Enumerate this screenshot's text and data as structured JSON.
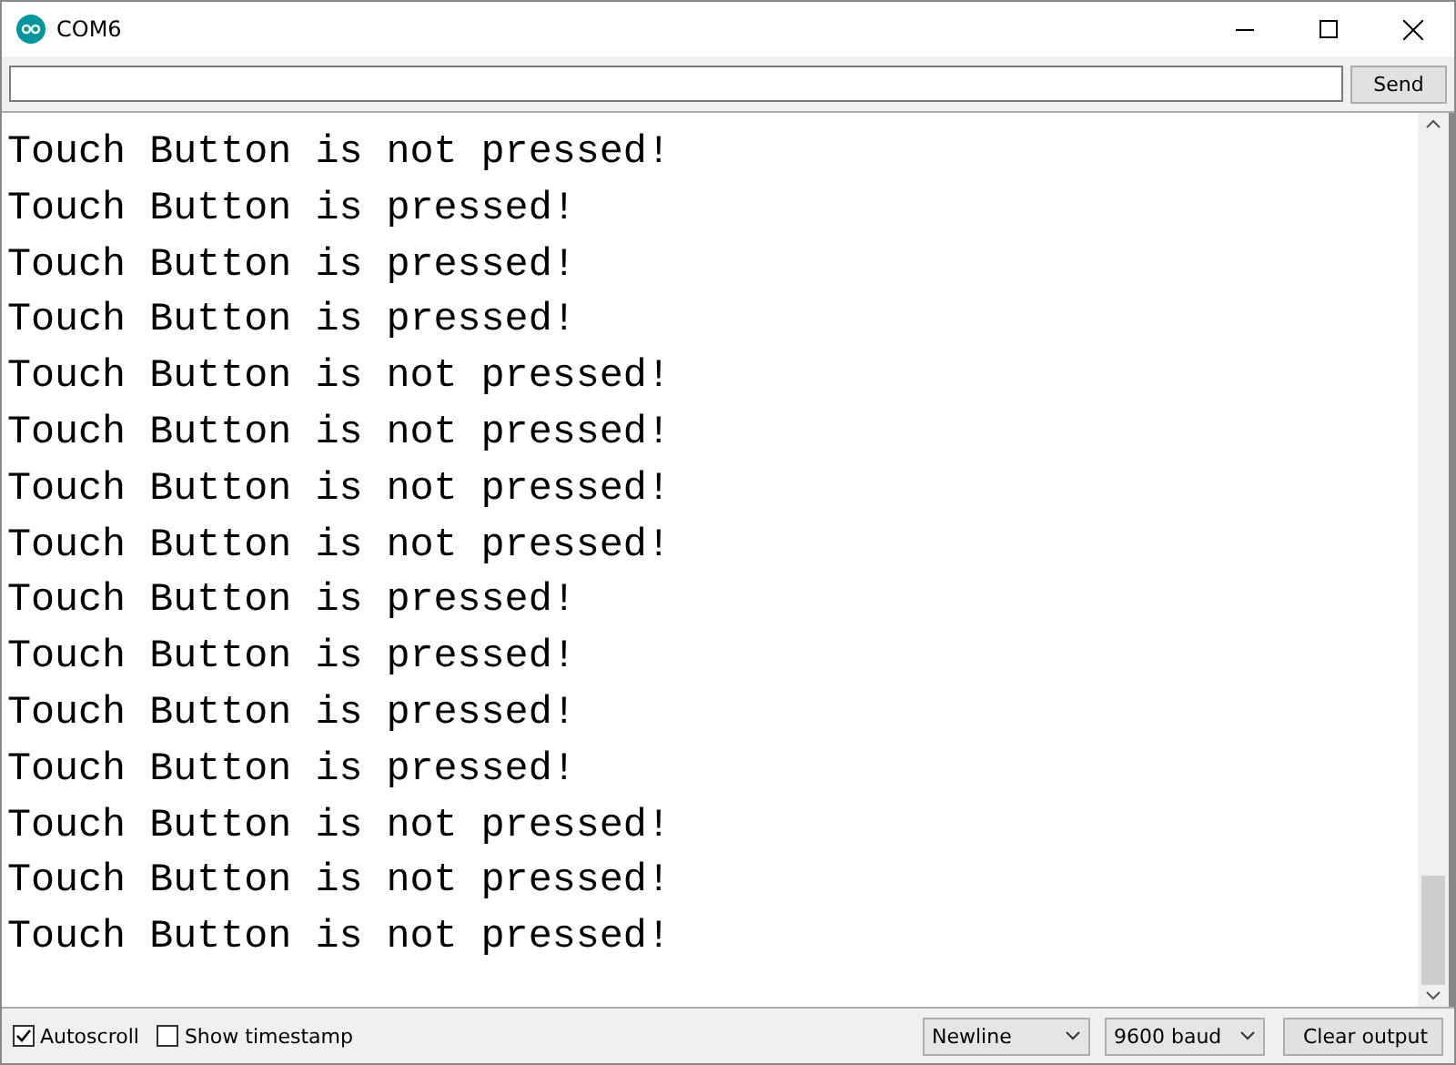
{
  "window": {
    "title": "COM6"
  },
  "send_button": "Send",
  "output_lines": [
    "Touch Button is not pressed!",
    "Touch Button is pressed!",
    "Touch Button is pressed!",
    "Touch Button is pressed!",
    "Touch Button is not pressed!",
    "Touch Button is not pressed!",
    "Touch Button is not pressed!",
    "Touch Button is not pressed!",
    "Touch Button is pressed!",
    "Touch Button is pressed!",
    "Touch Button is pressed!",
    "Touch Button is pressed!",
    "Touch Button is not pressed!",
    "Touch Button is not pressed!",
    "Touch Button is not pressed!"
  ],
  "autoscroll": {
    "label": "Autoscroll",
    "checked": true
  },
  "show_timestamp": {
    "label": "Show timestamp",
    "checked": false
  },
  "line_ending": "Newline",
  "baud_rate": "9600 baud",
  "clear_button": "Clear output"
}
